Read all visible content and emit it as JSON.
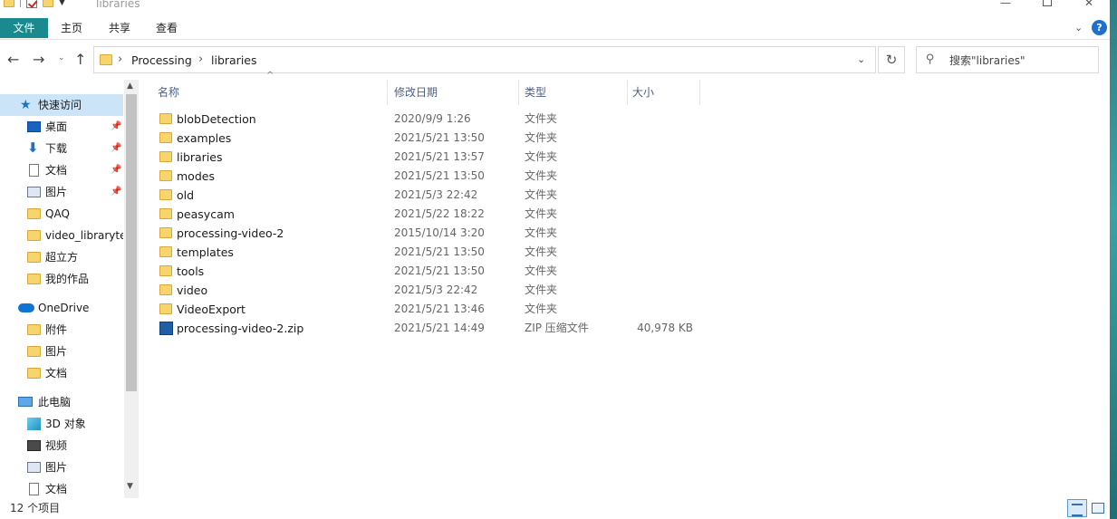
{
  "window": {
    "title": "libraries",
    "minimize_glyph": "—",
    "close_glyph": "✕"
  },
  "ribbon": {
    "tabs": [
      "文件",
      "主页",
      "共享",
      "查看"
    ],
    "collapse_glyph": "⌄",
    "help_glyph": "?"
  },
  "nav": {
    "back_glyph": "←",
    "forward_glyph": "→",
    "recent_glyph": "⌄",
    "up_glyph": "↑",
    "breadcrumb": [
      "Processing",
      "libraries"
    ],
    "crumb_sep": "›",
    "dropdown_glyph": "⌄",
    "refresh_glyph": "↻",
    "search_placeholder": "搜索\"libraries\"",
    "search_glyph": "⚲"
  },
  "sidebar": {
    "quick_access": "快速访问",
    "quick_items": [
      {
        "label": "桌面",
        "icon": "desktop-icon",
        "pinned": true
      },
      {
        "label": "下载",
        "icon": "download-icon",
        "pinned": true
      },
      {
        "label": "文档",
        "icon": "document-icon",
        "pinned": true
      },
      {
        "label": "图片",
        "icon": "picture-icon",
        "pinned": true
      },
      {
        "label": "QAQ",
        "icon": "folder-icon",
        "pinned": false
      },
      {
        "label": "video_libraryte",
        "icon": "folder-icon",
        "pinned": false
      },
      {
        "label": "超立方",
        "icon": "folder-icon",
        "pinned": false
      },
      {
        "label": "我的作品",
        "icon": "folder-icon",
        "pinned": false
      }
    ],
    "onedrive": "OneDrive",
    "onedrive_items": [
      "附件",
      "图片",
      "文档"
    ],
    "this_pc": "此电脑",
    "pc_items": [
      "3D 对象",
      "视频",
      "图片",
      "文档"
    ],
    "pin_glyph": "📌",
    "star_glyph": "★",
    "download_glyph": "⬇",
    "scroll_up_glyph": "▲",
    "scroll_down_glyph": "▼"
  },
  "columns": {
    "name": "名称",
    "date": "修改日期",
    "type": "类型",
    "size": "大小",
    "sort_glyph": "^"
  },
  "files": [
    {
      "name": "blobDetection",
      "date": "2020/9/9 1:26",
      "type": "文件夹",
      "size": "",
      "kind": "folder"
    },
    {
      "name": "examples",
      "date": "2021/5/21 13:50",
      "type": "文件夹",
      "size": "",
      "kind": "folder"
    },
    {
      "name": "libraries",
      "date": "2021/5/21 13:57",
      "type": "文件夹",
      "size": "",
      "kind": "folder"
    },
    {
      "name": "modes",
      "date": "2021/5/21 13:50",
      "type": "文件夹",
      "size": "",
      "kind": "folder"
    },
    {
      "name": "old",
      "date": "2021/5/3 22:42",
      "type": "文件夹",
      "size": "",
      "kind": "folder"
    },
    {
      "name": "peasycam",
      "date": "2021/5/22 18:22",
      "type": "文件夹",
      "size": "",
      "kind": "folder"
    },
    {
      "name": "processing-video-2",
      "date": "2015/10/14 3:20",
      "type": "文件夹",
      "size": "",
      "kind": "folder"
    },
    {
      "name": "templates",
      "date": "2021/5/21 13:50",
      "type": "文件夹",
      "size": "",
      "kind": "folder"
    },
    {
      "name": "tools",
      "date": "2021/5/21 13:50",
      "type": "文件夹",
      "size": "",
      "kind": "folder"
    },
    {
      "name": "video",
      "date": "2021/5/3 22:42",
      "type": "文件夹",
      "size": "",
      "kind": "folder"
    },
    {
      "name": "VideoExport",
      "date": "2021/5/21 13:46",
      "type": "文件夹",
      "size": "",
      "kind": "folder"
    },
    {
      "name": "processing-video-2.zip",
      "date": "2021/5/21 14:49",
      "type": "ZIP 压缩文件",
      "size": "40,978 KB",
      "kind": "zip"
    }
  ],
  "status": {
    "item_count": "12 个项目"
  },
  "colors": {
    "file_tab": "#1a8a8f",
    "selected_bg": "#cce4f7",
    "folder": "#f7d46c",
    "header_text": "#4d6082"
  }
}
